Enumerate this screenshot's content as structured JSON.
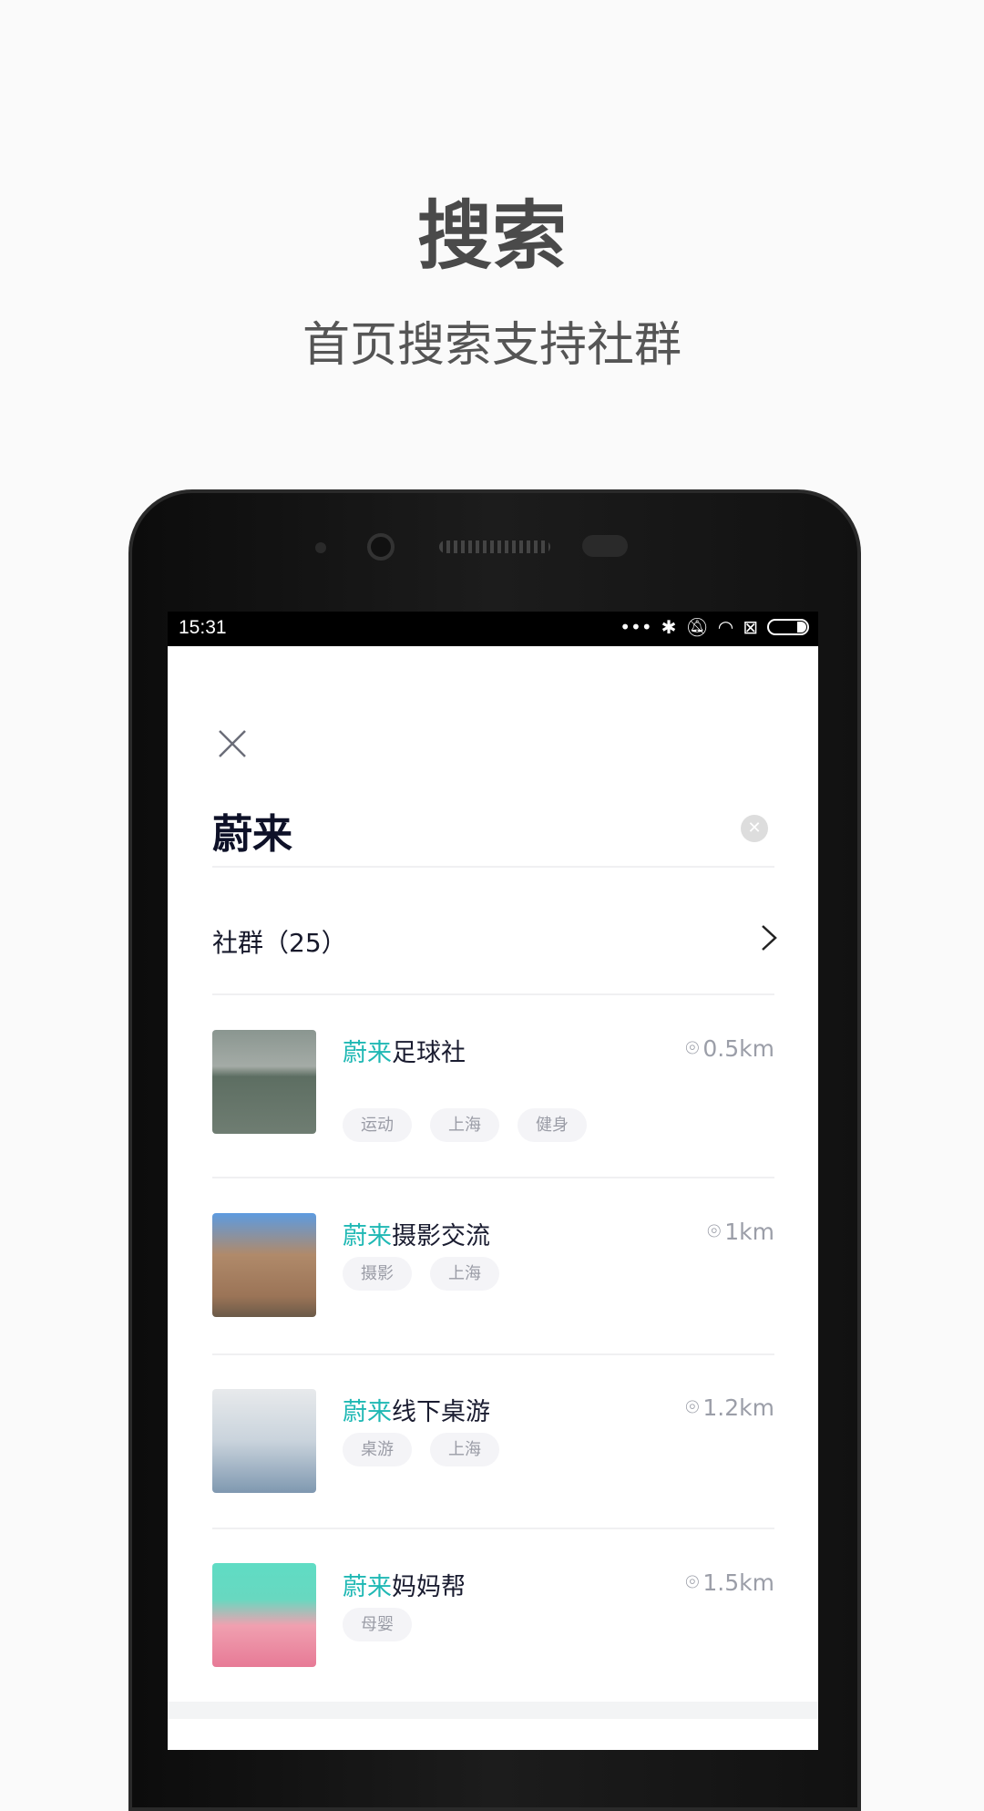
{
  "header": {
    "title": "搜索",
    "subtitle": "首页搜索支持社群"
  },
  "status_bar": {
    "time": "15:31",
    "icons": [
      "more-dots-icon",
      "bluetooth-icon",
      "mute-bell-icon",
      "wifi-icon",
      "sim-x-icon",
      "battery-icon"
    ]
  },
  "search": {
    "query": "蔚来",
    "close_icon": "close-icon",
    "clear_icon": "clear-icon"
  },
  "section": {
    "label": "社群（25）",
    "chevron": "chevron-right-icon"
  },
  "accent_color": "#1fb8b4",
  "results": [
    {
      "highlight": "蔚来",
      "rest": "足球社",
      "distance": "0.5km",
      "tags": [
        "运动",
        "上海",
        "健身"
      ]
    },
    {
      "highlight": "蔚来",
      "rest": "摄影交流",
      "distance": "1km",
      "tags": [
        "摄影",
        "上海"
      ]
    },
    {
      "highlight": "蔚来",
      "rest": "线下桌游",
      "distance": "1.2km",
      "tags": [
        "桌游",
        "上海"
      ]
    },
    {
      "highlight": "蔚来",
      "rest": "妈妈帮",
      "distance": "1.5km",
      "tags": [
        "母婴"
      ]
    }
  ]
}
